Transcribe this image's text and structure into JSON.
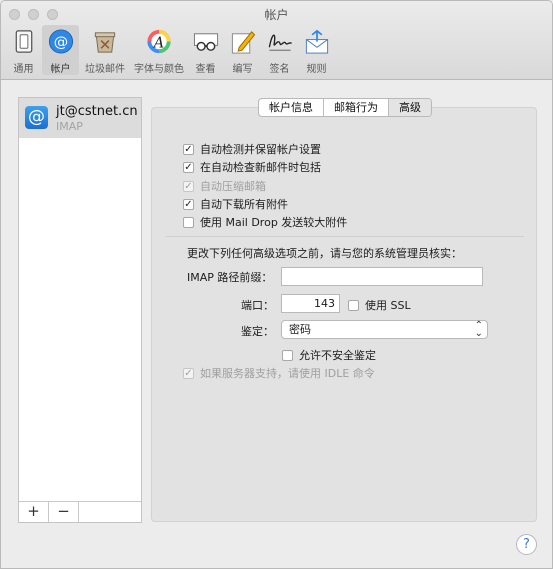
{
  "window": {
    "title": "帐户"
  },
  "toolbar": [
    {
      "label": "通用",
      "icon": "switch-icon"
    },
    {
      "label": "帐户",
      "icon": "at-sign-icon"
    },
    {
      "label": "垃圾邮件",
      "icon": "junk-mail-icon"
    },
    {
      "label": "字体与颜色",
      "icon": "font-color-icon"
    },
    {
      "label": "查看",
      "icon": "glasses-icon"
    },
    {
      "label": "编写",
      "icon": "pencil-pad-icon"
    },
    {
      "label": "签名",
      "icon": "signature-icon"
    },
    {
      "label": "规则",
      "icon": "rules-envelope-icon"
    }
  ],
  "accounts": [
    {
      "email": "jt@cstnet.cn",
      "type": "IMAP"
    }
  ],
  "list_buttons": {
    "add": "+",
    "remove": "−"
  },
  "tabs": [
    {
      "label": "帐户信息"
    },
    {
      "label": "邮箱行为"
    },
    {
      "label": "高级",
      "selected": true
    }
  ],
  "options": [
    {
      "label": "自动检测并保留帐户设置",
      "checked": true,
      "disabled": false
    },
    {
      "label": "在自动检查新邮件时包括",
      "checked": true,
      "disabled": false
    },
    {
      "label": "自动压缩邮箱",
      "checked": true,
      "disabled": true
    },
    {
      "label": "自动下载所有附件",
      "checked": true,
      "disabled": false
    },
    {
      "label": "使用 Mail Drop 发送较大附件",
      "checked": false,
      "disabled": false
    }
  ],
  "advanced": {
    "note": "更改下列任何高级选项之前，请与您的系统管理员核实：",
    "imap_prefix_label": "IMAP 路径前缀：",
    "imap_prefix_value": "",
    "port_label": "端口：",
    "port_value": "143",
    "ssl_label": "使用 SSL",
    "ssl_checked": false,
    "auth_label": "鉴定：",
    "auth_value": "密码",
    "insecure_label": "允许不安全鉴定",
    "insecure_checked": false,
    "idle_label": "如果服务器支持，请使用 IDLE 命令",
    "idle_checked": true
  },
  "help": {
    "label": "?"
  },
  "colors": {
    "accent": "#2f88e6"
  }
}
